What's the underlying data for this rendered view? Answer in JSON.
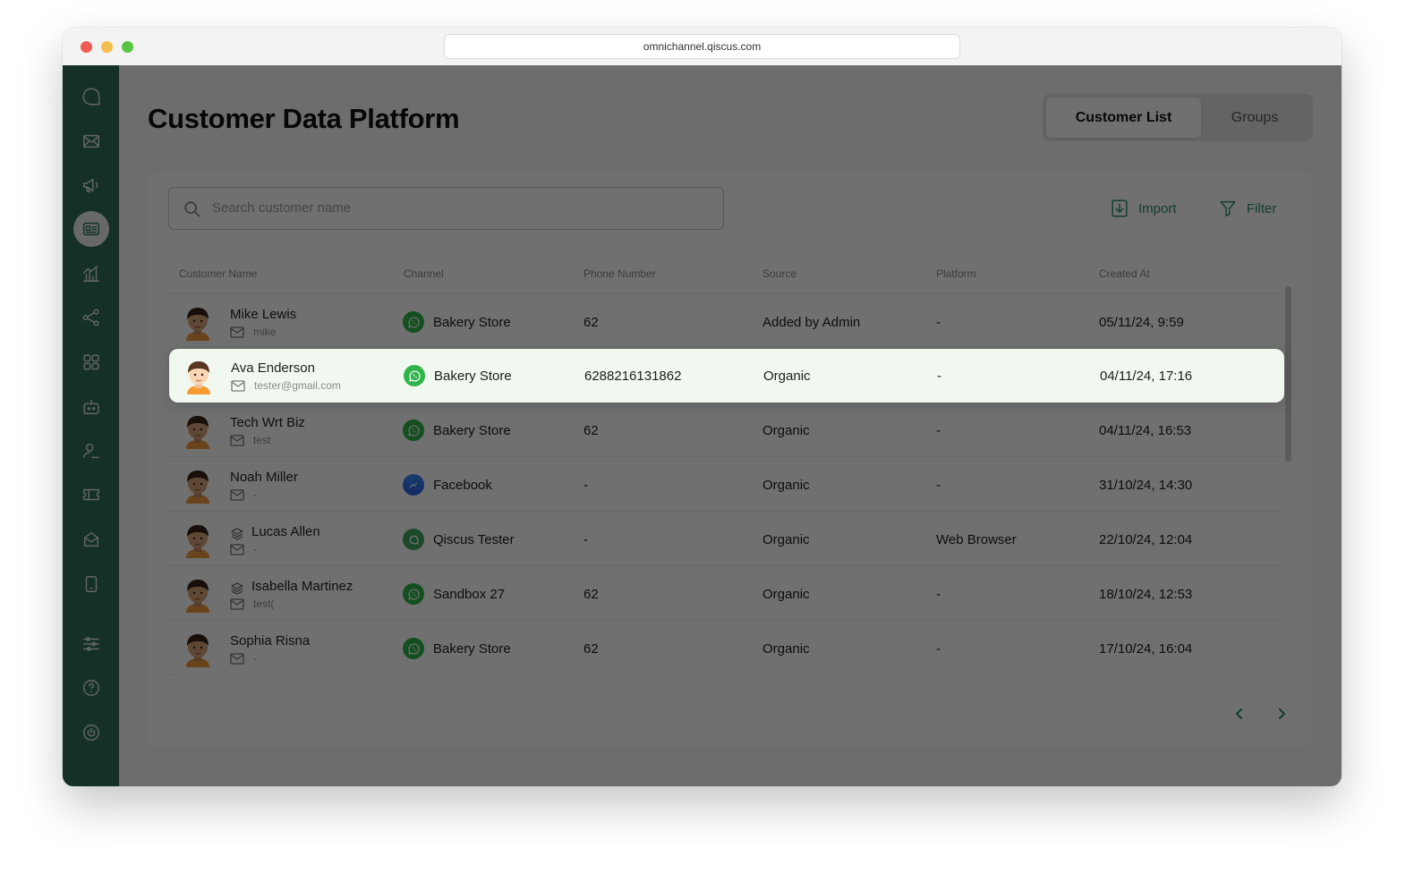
{
  "browser": {
    "url": "omnichannel.qiscus.com"
  },
  "page": {
    "title": "Customer Data Platform",
    "tabs": {
      "active": "Customer List",
      "inactive": "Groups"
    }
  },
  "search": {
    "placeholder": "Search customer name"
  },
  "actions": {
    "import": "Import",
    "filter": "Filter"
  },
  "table": {
    "headers": [
      "Customer Name",
      "Channel",
      "Phone Number",
      "Source",
      "Platform",
      "Created At"
    ],
    "rows": [
      {
        "name": "Mike Lewis",
        "email": "mike",
        "channel": "Bakery Store",
        "channel_icon": "whatsapp-icon",
        "phone": "62",
        "source": "Added by Admin",
        "platform": "-",
        "created": "05/11/24, 9:59"
      },
      {
        "name": "Ava Enderson",
        "email": "tester@gmail.com",
        "channel": "Bakery Store",
        "channel_icon": "whatsapp-icon",
        "phone": "6288216131862",
        "source": "Organic",
        "platform": "-",
        "created": "04/11/24, 17:16"
      },
      {
        "name": "Tech Wrt Biz",
        "email": "test",
        "channel": "Bakery Store",
        "channel_icon": "whatsapp-icon",
        "phone": "62",
        "source": "Organic",
        "platform": "-",
        "created": "04/11/24, 16:53"
      },
      {
        "name": "Noah Miller",
        "email": "-",
        "channel": "Facebook",
        "channel_icon": "messenger-icon",
        "phone": "-",
        "source": "Organic",
        "platform": "-",
        "created": "31/10/24, 14:30"
      },
      {
        "name": "Lucas Allen",
        "email": "-",
        "channel": "Qiscus Tester",
        "channel_icon": "qiscus-icon",
        "phone": "-",
        "source": "Organic",
        "platform": "Web Browser",
        "created": "22/10/24, 12:04"
      },
      {
        "name": "Isabella Martinez",
        "email": "test(",
        "channel": "Sandbox 27",
        "channel_icon": "whatsapp-icon",
        "phone": "62",
        "source": "Organic",
        "platform": "-",
        "created": "18/10/24, 12:53"
      },
      {
        "name": "Sophia Risna",
        "email": "-",
        "channel": "Bakery Store",
        "channel_icon": "whatsapp-icon",
        "phone": "62",
        "source": "Organic",
        "platform": "-",
        "created": "17/10/24, 16:04"
      }
    ]
  },
  "colors": {
    "sidebar": "#2f6d5c",
    "accent": "#2f8a6e",
    "highlight_row": "#eef6ee"
  }
}
